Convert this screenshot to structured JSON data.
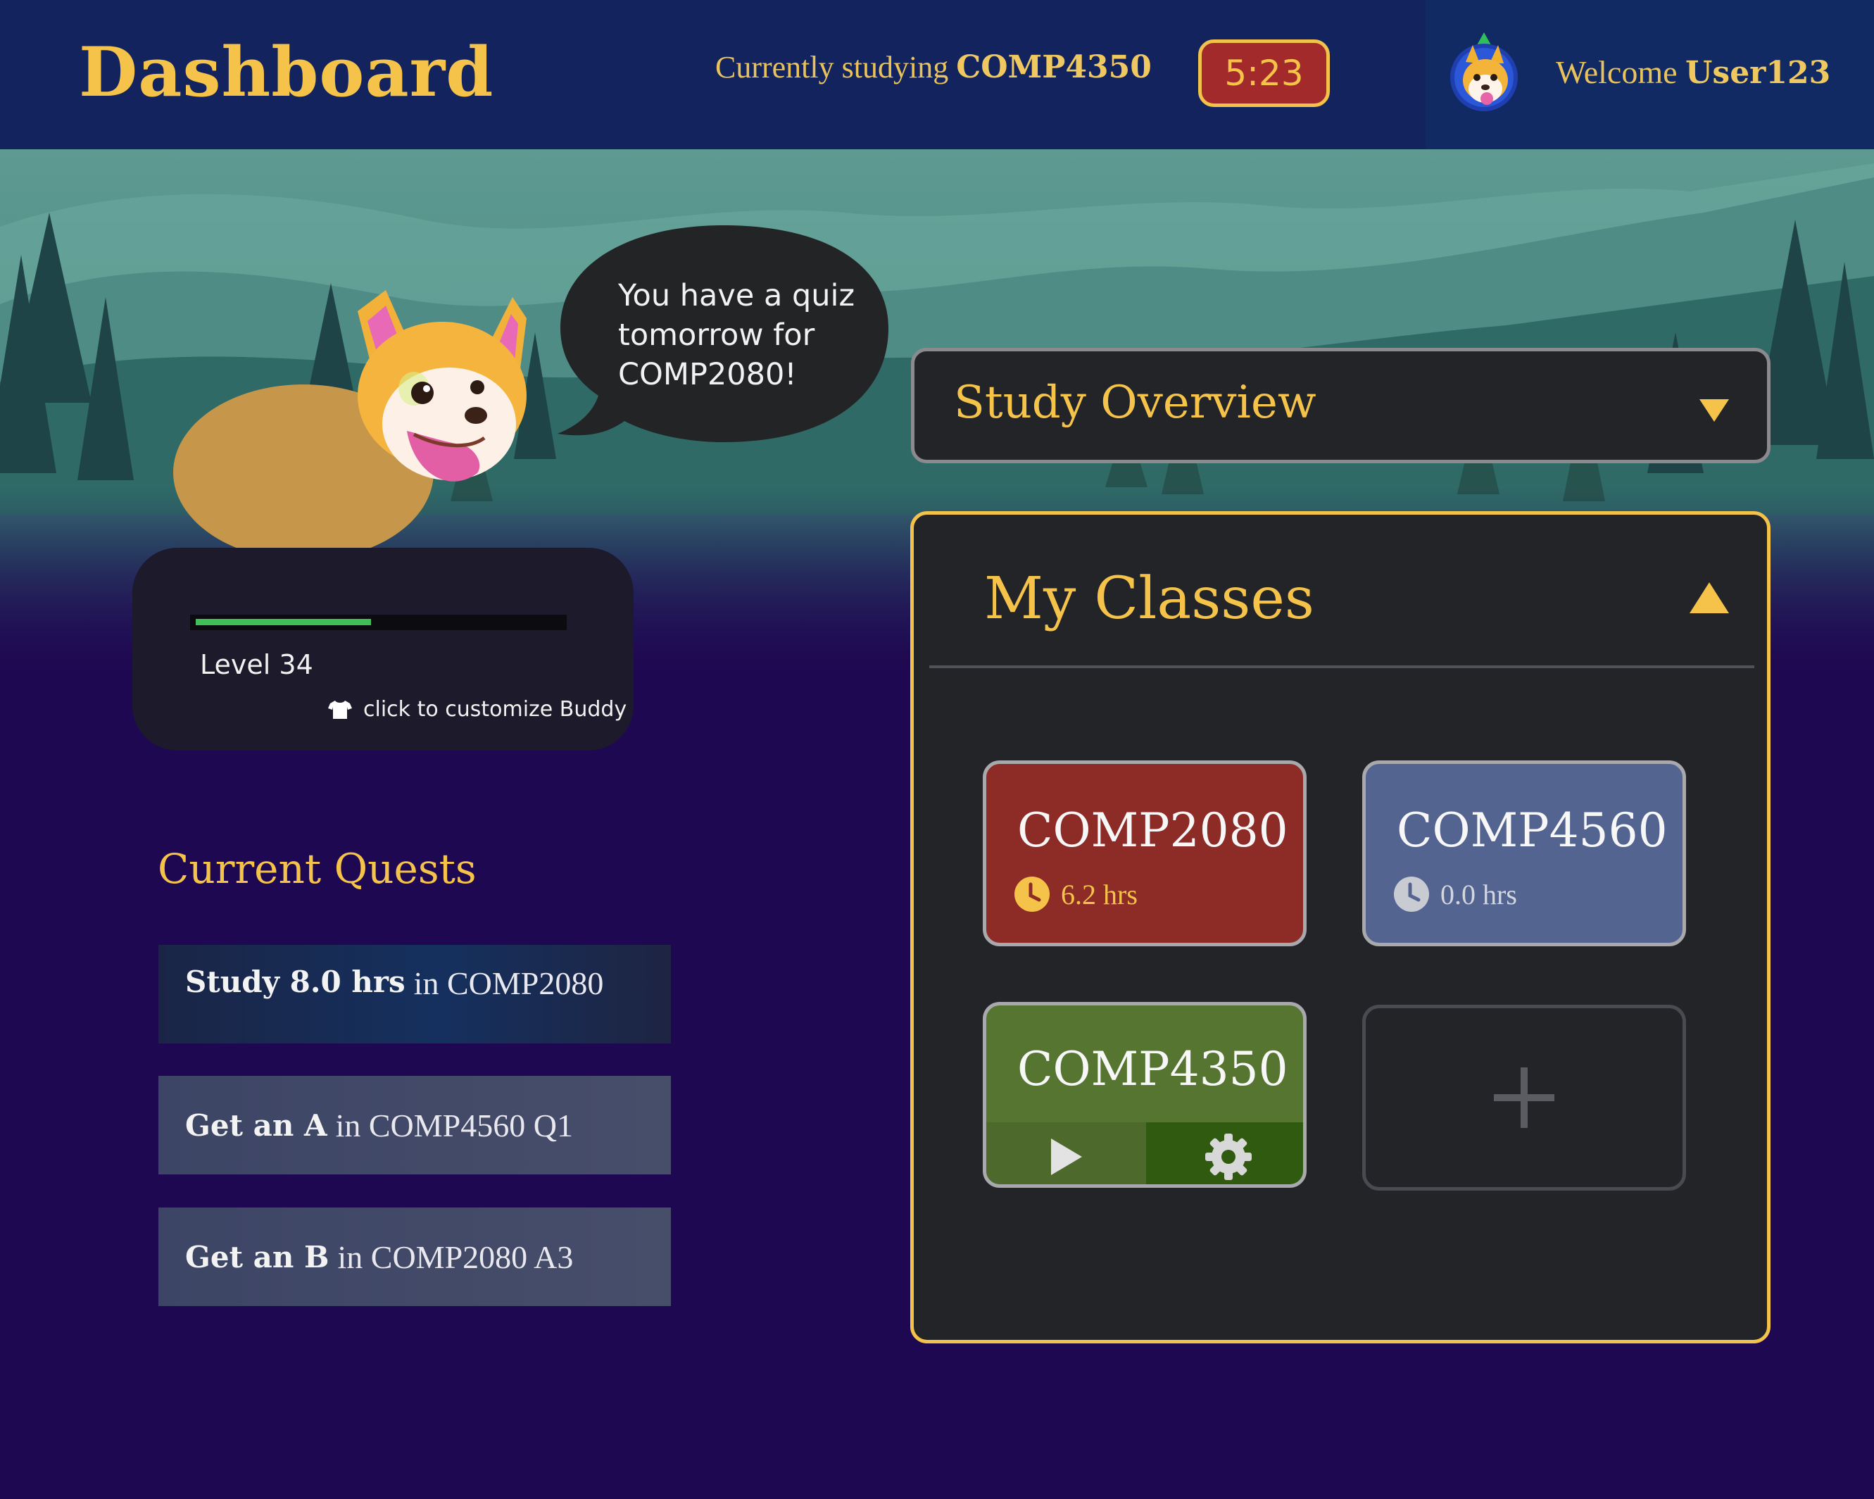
{
  "header": {
    "title": "Dashboard",
    "studying_prefix": "Currently studying",
    "studying_course": "COMP4350",
    "timer": "5:23",
    "welcome_prefix": "Welcome",
    "username": "User123"
  },
  "buddy": {
    "speech": "You have a quiz\ntomorrow for\nCOMP2080!",
    "xp_progress": 0.48,
    "level_label": "Level 34",
    "customize_label": "click to customize Buddy"
  },
  "quests": {
    "title": "Current Quests",
    "items": [
      {
        "bold": "Study 8.0 hrs",
        "rest": "in COMP2080"
      },
      {
        "bold": "Get an A",
        "rest": "in COMP4560 Q1"
      },
      {
        "bold": "Get an B",
        "rest": "in COMP2080 A3"
      }
    ]
  },
  "overview": {
    "title": "Study Overview"
  },
  "classes": {
    "title": "My Classes",
    "items": [
      {
        "name": "COMP2080",
        "hours": "6.2 hrs",
        "color": "#8d2b27"
      },
      {
        "name": "COMP4560",
        "hours": "0.0 hrs",
        "color": "#546491"
      },
      {
        "name": "COMP4350",
        "color": "#567530"
      }
    ]
  },
  "colors": {
    "accent": "#f5c34a",
    "header_bg": "#13235e",
    "page_bg": "#1f0852",
    "panel_bg": "#232427",
    "xp_bar": "#3ebf57"
  },
  "icons": {
    "timer": "none",
    "customize": "shirt-icon",
    "overview_toggle": "triangle-down-icon",
    "classes_toggle": "triangle-up-icon",
    "class_hours": "clock-icon",
    "start_session": "play-icon",
    "class_settings": "gear-icon",
    "add_class": "plus-icon"
  }
}
